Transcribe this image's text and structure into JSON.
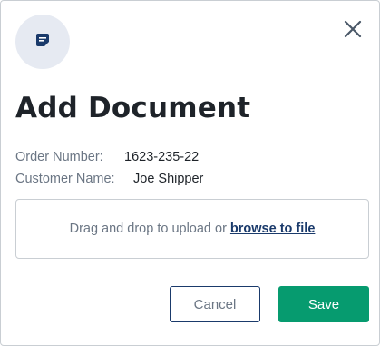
{
  "dialog": {
    "icon": "document-edit-icon",
    "close_icon": "close-icon",
    "title": "Add Document",
    "order": {
      "label": "Order Number:",
      "value": "1623-235-22"
    },
    "customer": {
      "label": "Customer Name:",
      "value": "Joe Shipper"
    },
    "dropzone": {
      "text": "Drag and drop to upload or",
      "link": "browse to file"
    },
    "buttons": {
      "cancel": "Cancel",
      "save": "Save"
    },
    "colors": {
      "accent": "#069b6f",
      "brand": "#1a3a6b",
      "badge_bg": "#e6eaf2"
    }
  }
}
